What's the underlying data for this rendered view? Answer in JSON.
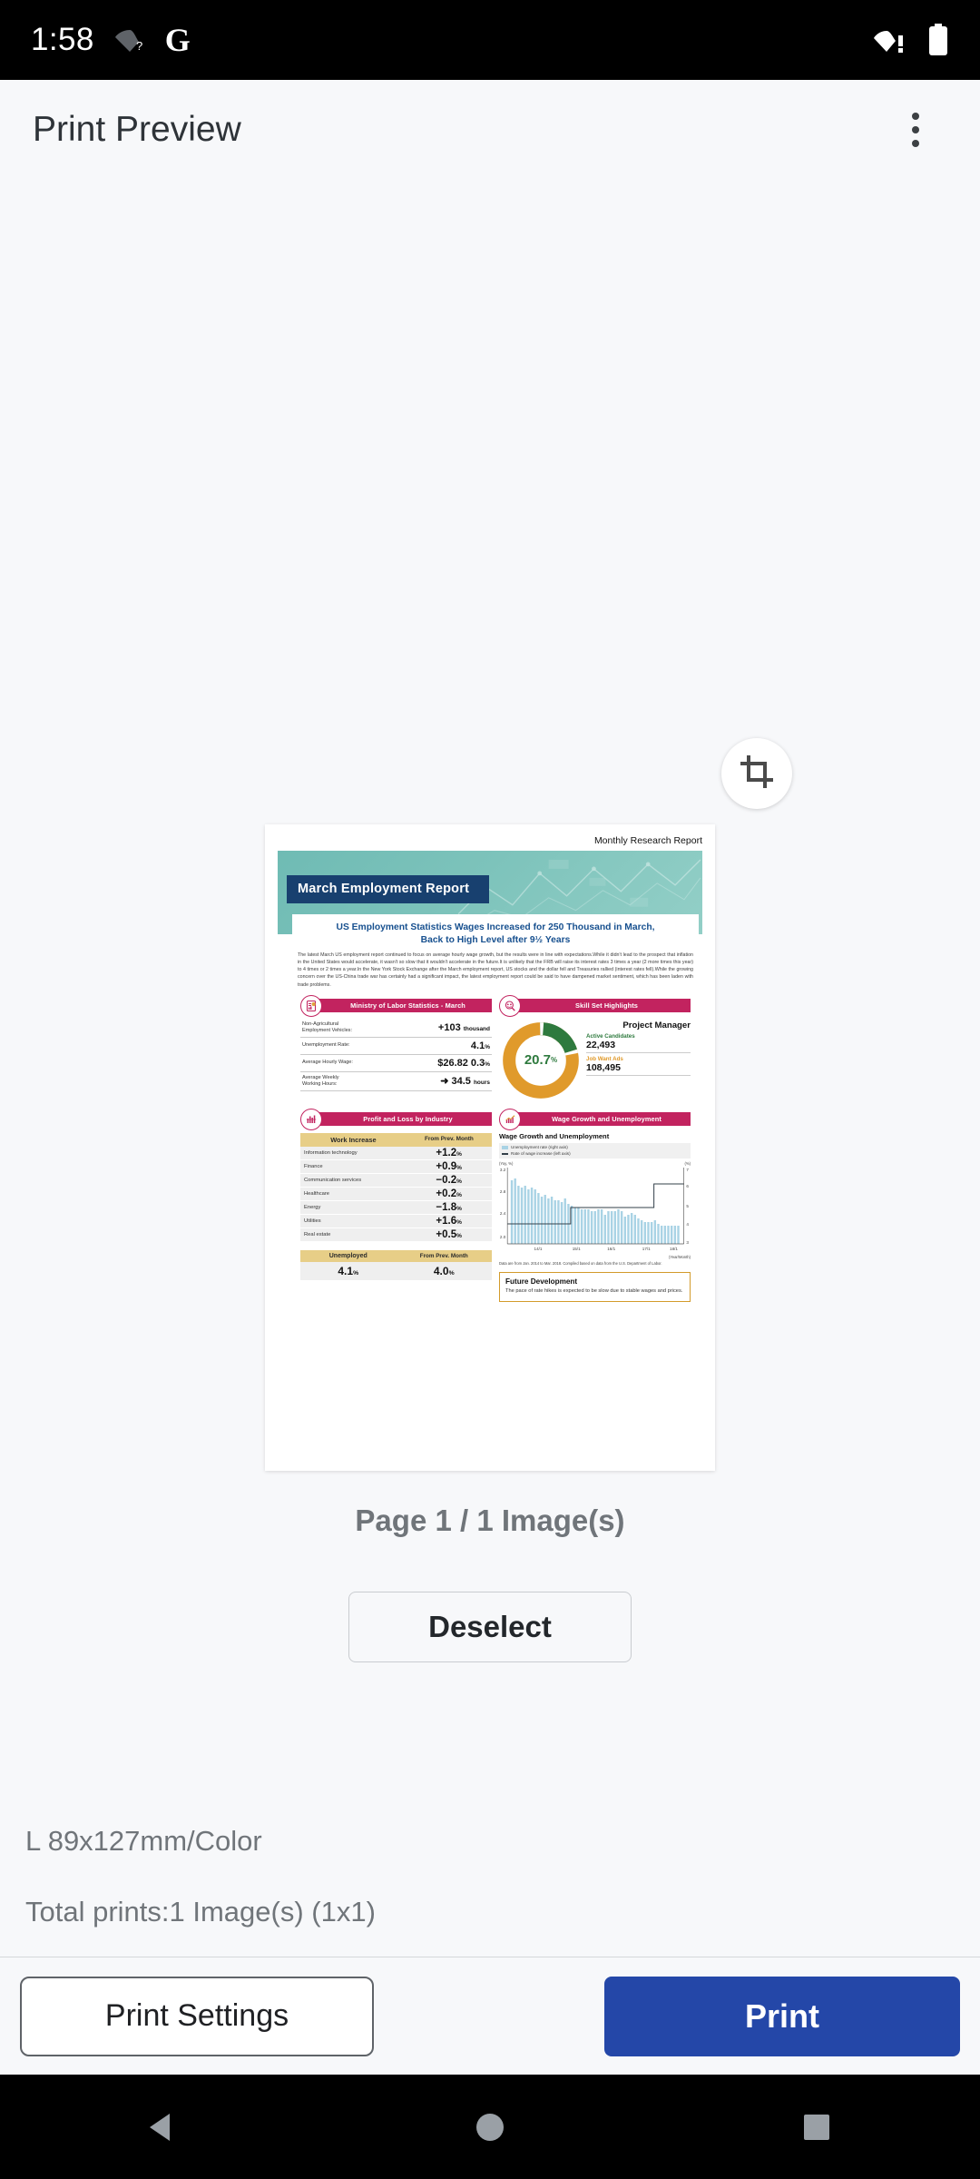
{
  "status_bar": {
    "clock": "1:58",
    "icons": [
      "wifi-question-icon",
      "google-g-icon",
      "wifi-alert-icon",
      "battery-icon"
    ],
    "google_glyph": "G"
  },
  "app_bar": {
    "title": "Print Preview",
    "overflow_label": "More options"
  },
  "preview": {
    "crop_icon": "crop-icon",
    "page_info": "Page 1 / 1 Image(s)",
    "deselect_label": "Deselect"
  },
  "document": {
    "kicker": "Monthly Research Report",
    "title": "March Employment Report",
    "headline_line1": "US Employment Statistics   Wages Increased for 250 Thousand in March,",
    "headline_line2": "Back to High Level after 9½ Years",
    "body": "The latest March US employment report continued to focus on average hourly wage growth, but the results were in line with expectations.While it didn't lead to the prospect that inflation in the United States would accelerate, it wasn't so slow that it wouldn't accelerate in the future.It is unlikely that the FRB will raise its interest rates 3 times a year (2 more times this year) to 4 times or 2 times a year.In the New York Stock Exchange after the March employment report, US stocks and the dollar fell and Treasuries rallied (interest rates fell).While the growing concern over the US-China trade war has certainly had a significant impact, the latest employment report could be said to have dampened market sentiment, which has been laden with trade problems.",
    "panel_labor": {
      "badge_icon": "clipboard-chart-icon",
      "title": "Ministry of Labor Statistics - March",
      "rows": [
        {
          "label": "Non-Agricultural Employment Vehicles:",
          "value": "+103",
          "unit": "thousand"
        },
        {
          "label": "Unemployment Rate:",
          "value": "4.1",
          "unit": "%"
        },
        {
          "label": "Average Hourly Wage:",
          "value": "$26.82 0.3",
          "unit": "%"
        },
        {
          "label": "Average Weekly Working Hours:",
          "value": "➜ 34.5",
          "unit": "hours"
        }
      ]
    },
    "panel_skill": {
      "badge_icon": "magnifier-people-icon",
      "title": "Skill Set Highlights",
      "role": "Project Manager",
      "donut_value": "20.7",
      "donut_unit": "%",
      "metrics": [
        {
          "key": "Active Candidates",
          "value": "22,493",
          "color": "#2E7A3E"
        },
        {
          "key": "Job Want Ads",
          "value": "108,495",
          "color": "#E09A2B"
        }
      ]
    },
    "panel_industry": {
      "badge_icon": "bar-chart-icon",
      "title": "Profit and Loss by Industry",
      "col1": "Work Increase",
      "col2": "From Prev. Month",
      "rows": [
        {
          "name": "Information technology",
          "change": "+1.2",
          "unit": "%"
        },
        {
          "name": "Finance",
          "change": "+0.9",
          "unit": "%"
        },
        {
          "name": "Communication services",
          "change": "−0.2",
          "unit": "%"
        },
        {
          "name": "Healthcare",
          "change": "+0.2",
          "unit": "%"
        },
        {
          "name": "Energy",
          "change": "−1.8",
          "unit": "%"
        },
        {
          "name": "Utilities",
          "change": "+1.6",
          "unit": "%"
        },
        {
          "name": "Real estate",
          "change": "+0.5",
          "unit": "%"
        }
      ],
      "unemployed_head": "Unemployed",
      "unemployed_head2": "From Prev. Month",
      "unemployed_value": "4.1",
      "unemployed_prev": "4.0",
      "unit": "%"
    },
    "panel_wage": {
      "badge_icon": "trend-chart-icon",
      "title": "Wage Growth and Unemployment",
      "chart_title": "Wage Growth and Unemployment",
      "legend_bar": "Unemployment rate (right axis)",
      "legend_line": "Rate of wage increase (left axis)",
      "note": "Data are from Jan. 2014 to Mar. 2018. Compiled based on data from the U.S. Department of Labor."
    },
    "future_box": {
      "title": "Future Development",
      "text": "The pace of rate hikes is expected to be slow due to stable wages and prices."
    }
  },
  "chart_data": {
    "type": "bar",
    "title": "Wage Growth and Unemployment",
    "xlabel": "(Year/Month)",
    "ylabel": "(Yoy, %)",
    "y2label": "(%)",
    "ylim": [
      1.5,
      3.2
    ],
    "y2lim": [
      3,
      7
    ],
    "yticks": [
      "3.2",
      "2.8",
      "2.4",
      "2.0"
    ],
    "y2ticks": [
      "7",
      "6",
      "5",
      "4",
      "3"
    ],
    "categories": [
      "14/1",
      "15/1",
      "16/1",
      "17/1",
      "18/1"
    ],
    "series": [
      {
        "name": "Unemployment rate (right axis)",
        "type": "bar",
        "color": "#A9D3E5",
        "values": [
          6.6,
          6.7,
          6.3,
          6.2,
          6.3,
          6.1,
          6.2,
          6.1,
          5.9,
          5.7,
          5.8,
          5.6,
          5.7,
          5.5,
          5.5,
          5.4,
          5.6,
          5.3,
          5.2,
          5.1,
          5.1,
          5.0,
          5.0,
          5.0,
          4.9,
          4.9,
          5.0,
          5.0,
          4.7,
          4.9,
          4.9,
          4.9,
          5.0,
          4.9,
          4.6,
          4.7,
          4.8,
          4.7,
          4.5,
          4.4,
          4.3,
          4.3,
          4.3,
          4.4,
          4.2,
          4.1,
          4.1,
          4.1,
          4.1,
          4.1,
          4.1
        ]
      },
      {
        "name": "Rate of wage increase (left axis)",
        "type": "line",
        "color": "#33404A",
        "values": [
          2.0,
          2.0,
          2.0,
          2.0,
          2.0,
          2.0,
          2.0,
          2.0,
          2.0,
          2.0,
          2.0,
          2.0,
          2.0,
          2.0,
          2.0,
          2.0,
          2.0,
          2.0,
          2.4,
          2.4,
          2.4,
          2.4,
          2.4,
          2.4,
          2.4,
          2.4,
          2.4,
          2.4,
          2.4,
          2.4,
          2.4,
          2.4,
          2.4,
          2.4,
          2.4,
          2.4,
          2.4,
          2.4,
          2.4,
          2.4,
          2.4,
          2.4,
          2.8,
          2.8,
          2.8,
          2.8,
          2.8,
          2.8,
          2.8,
          2.8,
          2.8
        ]
      }
    ],
    "legend_position": "top-right",
    "grid": false,
    "note": "Data are from Jan. 2014 to Mar. 2018. Compiled based on data from the U.S. Department of Labor."
  },
  "footer": {
    "media": "L 89x127mm/Color",
    "total": "Total prints:1 Image(s) (1x1)"
  },
  "actions": {
    "print_settings": "Print Settings",
    "print": "Print"
  },
  "nav_bar": {
    "back": "back-triangle-icon",
    "home": "home-circle-icon",
    "recents": "recents-square-icon"
  },
  "colors": {
    "accent_blue": "#2447A8",
    "magenta": "#C2235F",
    "gold": "#E7CE87",
    "donut_green": "#2E7A3E",
    "donut_orange": "#E09A2B",
    "bg": "#F7F8FA"
  }
}
